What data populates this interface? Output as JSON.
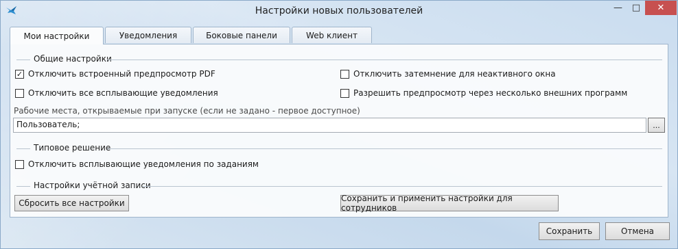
{
  "window": {
    "title": "Настройки новых пользователей",
    "icon": "bird-app-icon",
    "controls": {
      "minimize": "—",
      "maximize": "□",
      "close": "✕"
    }
  },
  "tabs": [
    {
      "label": "Мои настройки",
      "active": true
    },
    {
      "label": "Уведомления",
      "active": false
    },
    {
      "label": "Боковые панели",
      "active": false
    },
    {
      "label": "Web клиент",
      "active": false
    }
  ],
  "general": {
    "title": "Общие настройки",
    "options": [
      {
        "label": "Отключить встроенный предпросмотр PDF",
        "checked": true
      },
      {
        "label": "Отключить затемнение для неактивного окна",
        "checked": false
      },
      {
        "label": "Отключить все всплывающие уведомления",
        "checked": false
      },
      {
        "label": "Разрешить предпросмотр через несколько внешних программ",
        "checked": false
      }
    ],
    "workspaces_hint": "Рабочие места, открываемые при запуске (если не задано - первое доступное)",
    "workspaces_value": "Пользователь;",
    "browse_label": "..."
  },
  "typical": {
    "title": "Типовое решение",
    "options": [
      {
        "label": "Отключить всплывающие уведомления по заданиям",
        "checked": false
      }
    ]
  },
  "account": {
    "title": "Настройки учётной записи",
    "reset_label": "Сбросить все настройки",
    "save_apply_label": "Сохранить и применить настройки для сотрудников"
  },
  "footer": {
    "save_label": "Сохранить",
    "cancel_label": "Отмена"
  },
  "colors": {
    "close_button": "#c75050",
    "panel_border": "#9eb4cb",
    "window_bg": "#d0e0f0"
  }
}
